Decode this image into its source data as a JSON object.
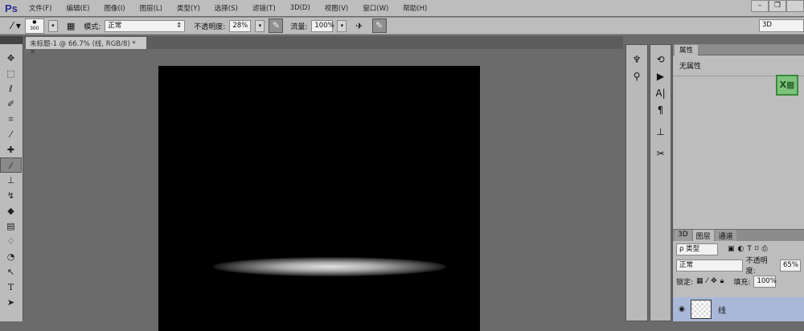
{
  "app": {
    "logo": "Ps"
  },
  "menu": [
    "文件(F)",
    "编辑(E)",
    "图像(I)",
    "图层(L)",
    "类型(Y)",
    "选择(S)",
    "滤镜(T)",
    "3D(D)",
    "视图(V)",
    "窗口(W)",
    "帮助(H)"
  ],
  "window_controls": {
    "minimize": "–",
    "restore": "❐"
  },
  "options": {
    "brush_size": "300",
    "mode_label": "模式:",
    "mode_value": "正常",
    "opacity_label": "不透明度:",
    "opacity_value": "28%",
    "flow_label": "流量:",
    "flow_value": "100%",
    "workspace": "3D"
  },
  "document": {
    "tab_title": "未标题-1 @ 66.7% (线, RGB/8) *",
    "close": "×"
  },
  "properties": {
    "tab": "属性",
    "content": "无属性"
  },
  "layers": {
    "tabs": [
      "3D",
      "图层",
      "通道"
    ],
    "filter_kind": "ρ 类型",
    "blend_mode": "正常",
    "opacity_label": "不透明度:",
    "opacity_value": "65%",
    "lock_label": "锁定:",
    "fill_label": "填充:",
    "fill_value": "100%",
    "layer_name": "线"
  },
  "tools": [
    "move",
    "marquee",
    "lasso",
    "quick-select",
    "crop",
    "eyedropper",
    "healing",
    "brush",
    "stamp",
    "history-brush",
    "eraser",
    "gradient",
    "blur",
    "dodge",
    "pen",
    "type",
    "path-select"
  ]
}
